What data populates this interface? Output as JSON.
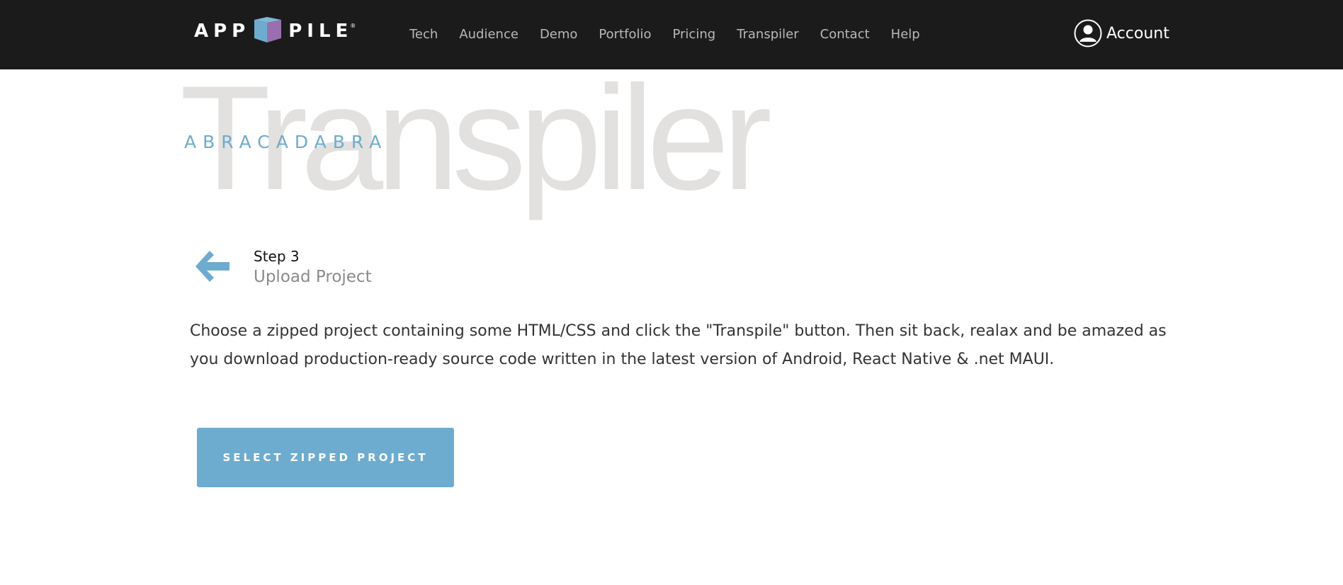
{
  "header": {
    "logo": {
      "text_left": "APP",
      "text_right": "PILE",
      "trademark": "®",
      "icon": "cube-logo-icon"
    },
    "nav": [
      {
        "label": "Tech"
      },
      {
        "label": "Audience"
      },
      {
        "label": "Demo"
      },
      {
        "label": "Portfolio"
      },
      {
        "label": "Pricing"
      },
      {
        "label": "Transpiler"
      },
      {
        "label": "Contact"
      },
      {
        "label": "Help"
      }
    ],
    "account": {
      "label": "Account",
      "icon": "user-avatar-icon"
    }
  },
  "hero": {
    "title": "Transpiler",
    "subtitle": "ABRACADABRA"
  },
  "step": {
    "back_icon": "arrow-left-icon",
    "number": "Step 3",
    "title": "Upload Project"
  },
  "description": "Choose a zipped project containing some HTML/CSS and click the \"Transpile\" button. Then sit back, realax and be amazed as you download production-ready source code written in the latest version of Android, React Native & .net MAUI.",
  "cta": {
    "label": "SELECT ZIPPED PROJECT"
  },
  "colors": {
    "header_bg": "#1b1b1b",
    "accent_blue": "#6dacce",
    "accent_purple": "#9a6fb0",
    "hero_watermark": "#e2e1df"
  }
}
